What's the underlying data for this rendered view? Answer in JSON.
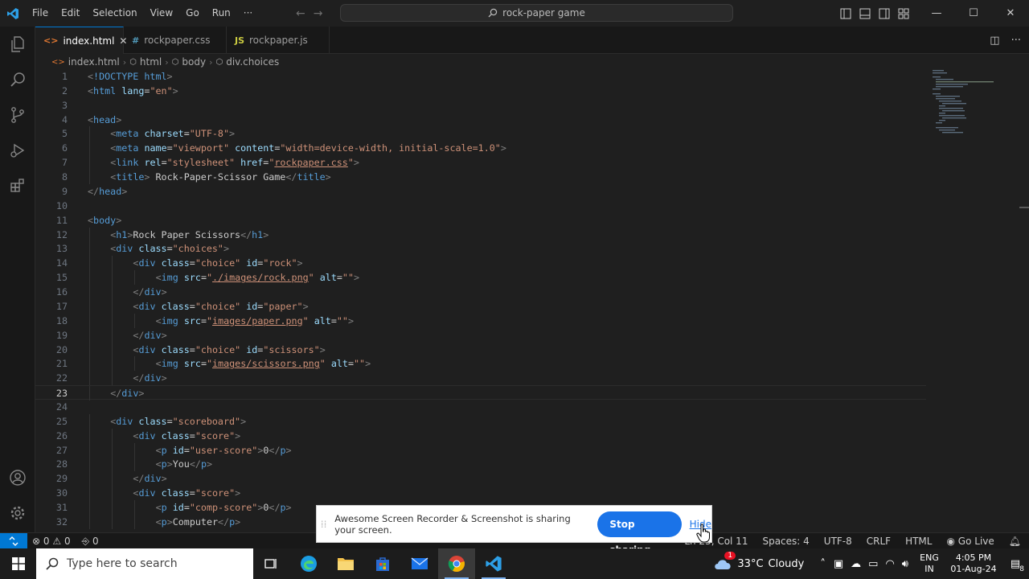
{
  "titlebar": {
    "menu": [
      "File",
      "Edit",
      "Selection",
      "View",
      "Go",
      "Run",
      "···"
    ],
    "search_text": "rock-paper game"
  },
  "tabs": [
    {
      "label": "index.html",
      "icon": "<>",
      "icon_color": "#e37933",
      "active": true
    },
    {
      "label": "rockpaper.css",
      "icon": "#",
      "icon_color": "#519aba",
      "active": false
    },
    {
      "label": "rockpaper.js",
      "icon": "JS",
      "icon_color": "#cbcb41",
      "active": false
    }
  ],
  "breadcrumb": [
    "index.html",
    "html",
    "body",
    "div.choices"
  ],
  "code_lines": [
    {
      "n": "1",
      "indent": 0,
      "tokens": [
        [
          "p",
          "<"
        ],
        [
          "t",
          "!DOCTYPE"
        ],
        [
          "x",
          " "
        ],
        [
          "t",
          "html"
        ],
        [
          "p",
          ">"
        ]
      ]
    },
    {
      "n": "2",
      "indent": 0,
      "tokens": [
        [
          "p",
          "<"
        ],
        [
          "t",
          "html"
        ],
        [
          "x",
          " "
        ],
        [
          "a",
          "lang"
        ],
        [
          "x",
          "="
        ],
        [
          "s",
          "\"en\""
        ],
        [
          "p",
          ">"
        ]
      ]
    },
    {
      "n": "3",
      "indent": 0,
      "tokens": []
    },
    {
      "n": "4",
      "indent": 0,
      "tokens": [
        [
          "p",
          "<"
        ],
        [
          "t",
          "head"
        ],
        [
          "p",
          ">"
        ]
      ]
    },
    {
      "n": "5",
      "indent": 1,
      "tokens": [
        [
          "p",
          "<"
        ],
        [
          "t",
          "meta"
        ],
        [
          "x",
          " "
        ],
        [
          "a",
          "charset"
        ],
        [
          "x",
          "="
        ],
        [
          "s",
          "\"UTF-8\""
        ],
        [
          "p",
          ">"
        ]
      ]
    },
    {
      "n": "6",
      "indent": 1,
      "tokens": [
        [
          "p",
          "<"
        ],
        [
          "t",
          "meta"
        ],
        [
          "x",
          " "
        ],
        [
          "a",
          "name"
        ],
        [
          "x",
          "="
        ],
        [
          "s",
          "\"viewport\""
        ],
        [
          "x",
          " "
        ],
        [
          "a",
          "content"
        ],
        [
          "x",
          "="
        ],
        [
          "s",
          "\"width=device-width, initial-scale=1.0\""
        ],
        [
          "p",
          ">"
        ]
      ]
    },
    {
      "n": "7",
      "indent": 1,
      "tokens": [
        [
          "p",
          "<"
        ],
        [
          "t",
          "link"
        ],
        [
          "x",
          " "
        ],
        [
          "a",
          "rel"
        ],
        [
          "x",
          "="
        ],
        [
          "s",
          "\"stylesheet\""
        ],
        [
          "x",
          " "
        ],
        [
          "a",
          "href"
        ],
        [
          "x",
          "="
        ],
        [
          "s",
          "\""
        ],
        [
          "l",
          "rockpaper.css"
        ],
        [
          "s",
          "\""
        ],
        [
          "p",
          ">"
        ]
      ]
    },
    {
      "n": "8",
      "indent": 1,
      "tokens": [
        [
          "p",
          "<"
        ],
        [
          "t",
          "title"
        ],
        [
          "p",
          ">"
        ],
        [
          "x",
          " Rock-Paper-Scissor Game"
        ],
        [
          "p",
          "</"
        ],
        [
          "t",
          "title"
        ],
        [
          "p",
          ">"
        ]
      ]
    },
    {
      "n": "9",
      "indent": 0,
      "tokens": [
        [
          "p",
          "</"
        ],
        [
          "t",
          "head"
        ],
        [
          "p",
          ">"
        ]
      ]
    },
    {
      "n": "10",
      "indent": 0,
      "tokens": []
    },
    {
      "n": "11",
      "indent": 0,
      "tokens": [
        [
          "p",
          "<"
        ],
        [
          "t",
          "body"
        ],
        [
          "p",
          ">"
        ]
      ]
    },
    {
      "n": "12",
      "indent": 1,
      "tokens": [
        [
          "p",
          "<"
        ],
        [
          "t",
          "h1"
        ],
        [
          "p",
          ">"
        ],
        [
          "x",
          "Rock Paper Scissors"
        ],
        [
          "p",
          "</"
        ],
        [
          "t",
          "h1"
        ],
        [
          "p",
          ">"
        ]
      ]
    },
    {
      "n": "13",
      "indent": 1,
      "tokens": [
        [
          "p",
          "<"
        ],
        [
          "t",
          "div"
        ],
        [
          "x",
          " "
        ],
        [
          "a",
          "class"
        ],
        [
          "x",
          "="
        ],
        [
          "s",
          "\"choices\""
        ],
        [
          "p",
          ">"
        ]
      ]
    },
    {
      "n": "14",
      "indent": 2,
      "tokens": [
        [
          "p",
          "<"
        ],
        [
          "t",
          "div"
        ],
        [
          "x",
          " "
        ],
        [
          "a",
          "class"
        ],
        [
          "x",
          "="
        ],
        [
          "s",
          "\"choice\""
        ],
        [
          "x",
          " "
        ],
        [
          "a",
          "id"
        ],
        [
          "x",
          "="
        ],
        [
          "s",
          "\"rock\""
        ],
        [
          "p",
          ">"
        ]
      ]
    },
    {
      "n": "15",
      "indent": 3,
      "tokens": [
        [
          "p",
          "<"
        ],
        [
          "t",
          "img"
        ],
        [
          "x",
          " "
        ],
        [
          "a",
          "src"
        ],
        [
          "x",
          "="
        ],
        [
          "s",
          "\""
        ],
        [
          "l",
          "./images/rock.png"
        ],
        [
          "s",
          "\""
        ],
        [
          "x",
          " "
        ],
        [
          "a",
          "alt"
        ],
        [
          "x",
          "="
        ],
        [
          "s",
          "\"\""
        ],
        [
          "p",
          ">"
        ]
      ]
    },
    {
      "n": "16",
      "indent": 2,
      "tokens": [
        [
          "p",
          "</"
        ],
        [
          "t",
          "div"
        ],
        [
          "p",
          ">"
        ]
      ]
    },
    {
      "n": "17",
      "indent": 2,
      "tokens": [
        [
          "p",
          "<"
        ],
        [
          "t",
          "div"
        ],
        [
          "x",
          " "
        ],
        [
          "a",
          "class"
        ],
        [
          "x",
          "="
        ],
        [
          "s",
          "\"choice\""
        ],
        [
          "x",
          " "
        ],
        [
          "a",
          "id"
        ],
        [
          "x",
          "="
        ],
        [
          "s",
          "\"paper\""
        ],
        [
          "p",
          ">"
        ]
      ]
    },
    {
      "n": "18",
      "indent": 3,
      "tokens": [
        [
          "p",
          "<"
        ],
        [
          "t",
          "img"
        ],
        [
          "x",
          " "
        ],
        [
          "a",
          "src"
        ],
        [
          "x",
          "="
        ],
        [
          "s",
          "\""
        ],
        [
          "l",
          "images/paper.png"
        ],
        [
          "s",
          "\""
        ],
        [
          "x",
          " "
        ],
        [
          "a",
          "alt"
        ],
        [
          "x",
          "="
        ],
        [
          "s",
          "\"\""
        ],
        [
          "p",
          ">"
        ]
      ]
    },
    {
      "n": "19",
      "indent": 2,
      "tokens": [
        [
          "p",
          "</"
        ],
        [
          "t",
          "div"
        ],
        [
          "p",
          ">"
        ]
      ]
    },
    {
      "n": "20",
      "indent": 2,
      "tokens": [
        [
          "p",
          "<"
        ],
        [
          "t",
          "div"
        ],
        [
          "x",
          " "
        ],
        [
          "a",
          "class"
        ],
        [
          "x",
          "="
        ],
        [
          "s",
          "\"choice\""
        ],
        [
          "x",
          " "
        ],
        [
          "a",
          "id"
        ],
        [
          "x",
          "="
        ],
        [
          "s",
          "\"scissors\""
        ],
        [
          "p",
          ">"
        ]
      ]
    },
    {
      "n": "21",
      "indent": 3,
      "tokens": [
        [
          "p",
          "<"
        ],
        [
          "t",
          "img"
        ],
        [
          "x",
          " "
        ],
        [
          "a",
          "src"
        ],
        [
          "x",
          "="
        ],
        [
          "s",
          "\""
        ],
        [
          "l",
          "images/scissors.png"
        ],
        [
          "s",
          "\""
        ],
        [
          "x",
          " "
        ],
        [
          "a",
          "alt"
        ],
        [
          "x",
          "="
        ],
        [
          "s",
          "\"\""
        ],
        [
          "p",
          ">"
        ]
      ]
    },
    {
      "n": "22",
      "indent": 2,
      "tokens": [
        [
          "p",
          "</"
        ],
        [
          "t",
          "div"
        ],
        [
          "p",
          ">"
        ]
      ]
    },
    {
      "n": "23",
      "indent": 1,
      "tokens": [
        [
          "p",
          "</"
        ],
        [
          "t",
          "div"
        ],
        [
          "p",
          ">"
        ]
      ],
      "current": true
    },
    {
      "n": "24",
      "indent": 0,
      "tokens": []
    },
    {
      "n": "25",
      "indent": 1,
      "tokens": [
        [
          "p",
          "<"
        ],
        [
          "t",
          "div"
        ],
        [
          "x",
          " "
        ],
        [
          "a",
          "class"
        ],
        [
          "x",
          "="
        ],
        [
          "s",
          "\"scoreboard\""
        ],
        [
          "p",
          ">"
        ]
      ]
    },
    {
      "n": "26",
      "indent": 2,
      "tokens": [
        [
          "p",
          "<"
        ],
        [
          "t",
          "div"
        ],
        [
          "x",
          " "
        ],
        [
          "a",
          "class"
        ],
        [
          "x",
          "="
        ],
        [
          "s",
          "\"score\""
        ],
        [
          "p",
          ">"
        ]
      ]
    },
    {
      "n": "27",
      "indent": 3,
      "tokens": [
        [
          "p",
          "<"
        ],
        [
          "t",
          "p"
        ],
        [
          "x",
          " "
        ],
        [
          "a",
          "id"
        ],
        [
          "x",
          "="
        ],
        [
          "s",
          "\"user-score\""
        ],
        [
          "p",
          ">"
        ],
        [
          "x",
          "0"
        ],
        [
          "p",
          "</"
        ],
        [
          "t",
          "p"
        ],
        [
          "p",
          ">"
        ]
      ]
    },
    {
      "n": "28",
      "indent": 3,
      "tokens": [
        [
          "p",
          "<"
        ],
        [
          "t",
          "p"
        ],
        [
          "p",
          ">"
        ],
        [
          "x",
          "You"
        ],
        [
          "p",
          "</"
        ],
        [
          "t",
          "p"
        ],
        [
          "p",
          ">"
        ]
      ]
    },
    {
      "n": "29",
      "indent": 2,
      "tokens": [
        [
          "p",
          "</"
        ],
        [
          "t",
          "div"
        ],
        [
          "p",
          ">"
        ]
      ]
    },
    {
      "n": "30",
      "indent": 2,
      "tokens": [
        [
          "p",
          "<"
        ],
        [
          "t",
          "div"
        ],
        [
          "x",
          " "
        ],
        [
          "a",
          "class"
        ],
        [
          "x",
          "="
        ],
        [
          "s",
          "\"score\""
        ],
        [
          "p",
          ">"
        ]
      ]
    },
    {
      "n": "31",
      "indent": 3,
      "tokens": [
        [
          "p",
          "<"
        ],
        [
          "t",
          "p"
        ],
        [
          "x",
          " "
        ],
        [
          "a",
          "id"
        ],
        [
          "x",
          "="
        ],
        [
          "s",
          "\"comp-score\""
        ],
        [
          "p",
          ">"
        ],
        [
          "x",
          "0"
        ],
        [
          "p",
          "</"
        ],
        [
          "t",
          "p"
        ],
        [
          "p",
          ">"
        ]
      ]
    },
    {
      "n": "32",
      "indent": 3,
      "tokens": [
        [
          "p",
          "<"
        ],
        [
          "t",
          "p"
        ],
        [
          "p",
          ">"
        ],
        [
          "x",
          "Computer"
        ],
        [
          "p",
          "</"
        ],
        [
          "t",
          "p"
        ],
        [
          "p",
          ">"
        ]
      ]
    }
  ],
  "statusbar": {
    "errors": "0",
    "warnings": "0",
    "ports": "0",
    "position": "Ln 23, Col 11",
    "spaces": "Spaces: 4",
    "encoding": "UTF-8",
    "eol": "CRLF",
    "language": "HTML",
    "golive": "Go Live"
  },
  "share_banner": {
    "message": "Awesome Screen Recorder & Screenshot is sharing your screen.",
    "stop_label": "Stop sharing",
    "hide_label": "Hide"
  },
  "taskbar": {
    "search_placeholder": "Type here to search",
    "weather_temp": "33°C",
    "weather_text": "Cloudy",
    "weather_badge": "1",
    "lang_top": "ENG",
    "lang_bottom": "IN",
    "time": "4:05 PM",
    "date": "01-Aug-24",
    "notif_count": "8"
  },
  "colors": {
    "accent": "#0078d4",
    "editor_bg": "#1f1f1f",
    "stop_button": "#1a73e8"
  }
}
